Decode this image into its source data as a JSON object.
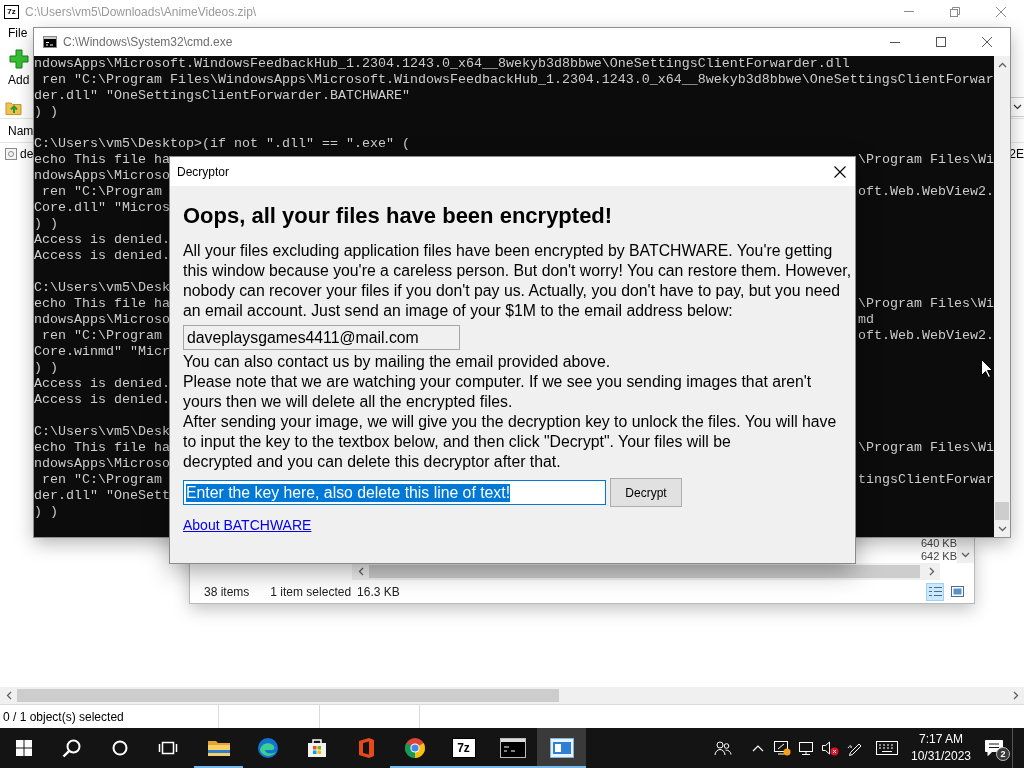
{
  "archive_window": {
    "icon_label": "7z",
    "title": "C:\\Users\\vm5\\Downloads\\AnimeVideos.zip\\",
    "maximized": true,
    "menu": [
      "File"
    ],
    "toolbar": [
      {
        "kind": "add",
        "label": "Add"
      }
    ],
    "columns": [
      "Nam"
    ],
    "rows": [
      {
        "name": "de",
        "last_column": "2E"
      }
    ],
    "status": "0 / 1 object(s) selected"
  },
  "explorer_window": {
    "sizes": [
      "640 KB",
      "642 KB"
    ],
    "status": {
      "items": "38 items",
      "selection": "1 item selected",
      "size": "16.3 KB"
    },
    "views": [
      {
        "kind": "details",
        "selected": true
      },
      {
        "kind": "preview",
        "selected": false
      }
    ]
  },
  "console_window": {
    "title": "C:\\Windows\\System32\\cmd.exe",
    "maximized": false,
    "blocks": [
      {
        "lines": [
          {
            "kind": "plain",
            "text": "ndowsApps\\Microsoft.WindowsFeedbackHub_1.2304.1243.0_x64__8wekyb3d8bbwe\\OneSettingsClientForwarder.dll"
          },
          {
            "kind": "plain",
            "text": " ren \"C:\\Program Files\\WindowsApps\\Microsoft.WindowsFeedbackHub_1.2304.1243.0_x64__8wekyb3d8bbwe\\OneSettingsClientForwar"
          },
          {
            "kind": "plain",
            "text": "der.dll\" \"OneSettingsClientForwarder.BATCHWARE\""
          },
          {
            "kind": "plain",
            "text": ") )"
          }
        ]
      },
      {
        "lines": [
          {
            "kind": "plain",
            "text": "C:\\Users\\vm5\\Desktop>(if not \".dll\" == \".exe\" ("
          },
          {
            "kind": "split",
            "left": "echo This file ha",
            "right": "\\Program Files\\Wi"
          },
          {
            "kind": "plain",
            "text": "ndowsApps\\Microso"
          },
          {
            "kind": "split",
            "left": " ren \"C:\\Program",
            "right": "oft.Web.WebView2."
          },
          {
            "kind": "plain",
            "text": "Core.dll\" \"Micros"
          },
          {
            "kind": "plain",
            "text": ") )"
          },
          {
            "kind": "plain",
            "text": "Access is denied."
          },
          {
            "kind": "plain",
            "text": "Access is denied."
          }
        ]
      },
      {
        "lines": [
          {
            "kind": "plain",
            "text": "C:\\Users\\vm5\\Desk"
          },
          {
            "kind": "split",
            "left": "echo This file ha",
            "right": "\\Program Files\\Wi"
          },
          {
            "kind": "split",
            "left": "ndowsApps\\Microso",
            "right": "md"
          },
          {
            "kind": "split",
            "left": " ren \"C:\\Program",
            "right": "oft.Web.WebView2."
          },
          {
            "kind": "plain",
            "text": "Core.winmd\" \"Micr"
          },
          {
            "kind": "plain",
            "text": ") )"
          },
          {
            "kind": "plain",
            "text": "Access is denied."
          },
          {
            "kind": "plain",
            "text": "Access is denied."
          }
        ]
      },
      {
        "lines": [
          {
            "kind": "plain",
            "text": "C:\\Users\\vm5\\Desk"
          },
          {
            "kind": "split",
            "left": "echo This file ha",
            "right": "\\Program Files\\Wi"
          },
          {
            "kind": "plain",
            "text": "ndowsApps\\Microso"
          },
          {
            "kind": "split",
            "left": " ren \"C:\\Program",
            "right": "tingsClientForwar"
          },
          {
            "kind": "plain",
            "text": "der.dll\" \"OneSett"
          },
          {
            "kind": "plain",
            "text": ") )"
          }
        ]
      }
    ]
  },
  "dialog": {
    "title": "Decryptor",
    "heading": "Oops, all your files have been encrypted!",
    "message": "All your files excluding application files have been encrypted by BATCHWARE. You're getting this window because you're a careless person. But don't worry! You can restore them. However, nobody can recover your files if you don't pay us. Actually, you don't have to pay, but you need an email account. Just send an image of your $1M to the email address below:",
    "email_field": {
      "value": "daveplaysgames4411@mail.com"
    },
    "notes": [
      "You can also contact us by mailing the email provided above.",
      "Please note that we are watching your computer. If we see you sending images that aren't yours then we will delete all the encrypted files.",
      "After sending your image, we will give you the decryption key to unlock the files. You will have to input the key to the textbox below, and then click \"Decrypt\". Your files will be\ndecrypted and you can delete this decryptor after that."
    ],
    "key_field": {
      "value": "Enter the key here, also delete this line of text!",
      "selected": true
    },
    "decrypt_button": {
      "label": "Decrypt"
    },
    "link": "About BATCHWARE"
  },
  "taskbar": {
    "buttons": [
      {
        "kind": "start"
      },
      {
        "kind": "search"
      },
      {
        "kind": "assistant"
      },
      {
        "kind": "task-view"
      }
    ],
    "apps": [
      {
        "kind": "folder",
        "running": true,
        "active": false
      },
      {
        "kind": "edge",
        "running": false,
        "active": false
      },
      {
        "kind": "store",
        "running": false,
        "active": false
      },
      {
        "kind": "office",
        "running": false,
        "active": false
      },
      {
        "kind": "chrome",
        "running": true,
        "active": false
      },
      {
        "kind": "archiver",
        "label": "7z",
        "running": true,
        "active": false
      },
      {
        "kind": "terminal",
        "running": true,
        "active": false
      },
      {
        "kind": "window",
        "running": true,
        "active": true
      }
    ],
    "tray": [
      {
        "kind": "people"
      },
      {
        "kind": "chevron"
      },
      {
        "kind": "security"
      },
      {
        "kind": "network"
      },
      {
        "kind": "volume-muted"
      },
      {
        "kind": "pen"
      },
      {
        "kind": "keyboard"
      }
    ],
    "clock": {
      "time": "7:17 AM",
      "date": "10/31/2023"
    },
    "notifications": {
      "count": "2"
    }
  }
}
